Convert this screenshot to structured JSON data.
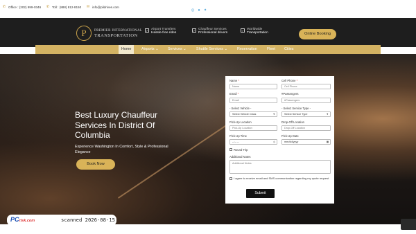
{
  "topbar": {
    "office": "Office : (202) 999-0346",
    "toll": "Toll : (888) 812-8150",
    "email": "info@pildrives.com",
    "icons": {
      "phone": "phone-icon",
      "mail": "mail-icon"
    },
    "socials": [
      "instagram-icon",
      "facebook-icon",
      "twitter-icon"
    ]
  },
  "header": {
    "logo_mark": "P",
    "logo_line1": "PREMIER INTERNATIONAL",
    "logo_line2": "TRANSPORTATION",
    "features": [
      {
        "line1": "Airport Transfers",
        "line2": "Hassle-free rides"
      },
      {
        "line1": "Chauffeur Services",
        "line2": "Professional drivers"
      },
      {
        "line1": "Worldwide",
        "line2": "Transportation"
      }
    ],
    "booking_label": "Online Booking",
    "check_glyph": "✓"
  },
  "nav": {
    "items": [
      {
        "label": "Home",
        "active": true
      },
      {
        "label": "Airports ⌄"
      },
      {
        "label": "Services ⌄"
      },
      {
        "label": "Shuttle Services ⌄"
      },
      {
        "label": "Reservation"
      },
      {
        "label": "Fleet"
      },
      {
        "label": "Cities"
      }
    ]
  },
  "hero": {
    "title": "Best Luxury Chauffeur Services In District Of Columbia",
    "subtitle": "Experience Washington In Comfort, Style & Professional Elegance",
    "button": "Book Now"
  },
  "form": {
    "name_label": "Name",
    "name_placeholder": "Name",
    "cell_label": "Cell Phone",
    "cell_placeholder": "Cell Phone",
    "email_label": "Email",
    "email_placeholder": "Email",
    "passengers_label": "#Passengers",
    "passengers_placeholder": "#Passengers",
    "vehicle_label": "- Select Vehicle -",
    "vehicle_value": "Select Vehicle Class",
    "service_label": "- Select Service Type -",
    "service_value": "Select Service Type",
    "pickup_loc_label": "Pick-Up Location",
    "pickup_loc_placeholder": "Pick-Up Location",
    "dropoff_label": "Drop-Off Location",
    "dropoff_placeholder": "Drop-Off Location",
    "pickup_time_label": "Pick-Up Time",
    "pickup_time_value": "--:-- --",
    "pickup_date_label": "Pick-Up Date",
    "pickup_date_value": "mm/dd/yyyy",
    "round_trip_label": "Round Trip",
    "notes_label": "Additional Notes",
    "notes_placeholder": "Additional Notes",
    "consent_label": "I agree to receive email and SMS communication regarding my quote request",
    "submit_label": "Submit",
    "required_mark": "*"
  },
  "watermark": {
    "brand_pc": "PC",
    "brand_risk": "risk.com",
    "scanned": "scanned 2026-08-15"
  },
  "colors": {
    "gold": "#d4b363",
    "dark": "#1e1e1e",
    "social": "#3d9bd6"
  }
}
